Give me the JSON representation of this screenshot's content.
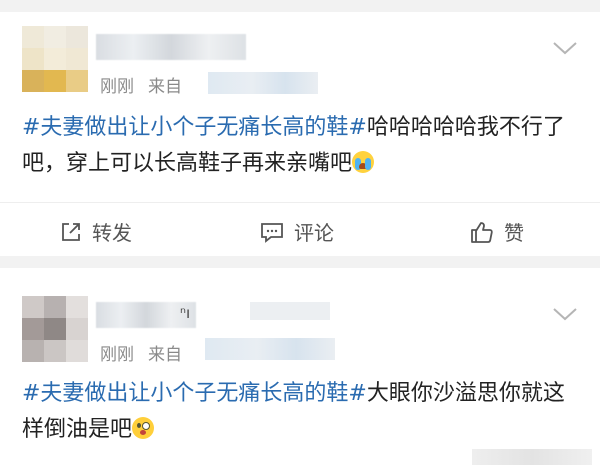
{
  "posts": [
    {
      "timestamp": "刚刚",
      "source_prefix": "来自",
      "topic": "#夫妻做出让小个子无痛长高的鞋#",
      "text": "哈哈哈哈哈我不行了吧，穿上可以长高鞋子再来亲嘴吧",
      "emoji": "loudly-crying-face",
      "avatar_colors": [
        "#efe9d8",
        "#f1ede2",
        "#ece7dc",
        "#eee4c8",
        "#f3ecd9",
        "#f0e8d4",
        "#d9b25a",
        "#e2b850",
        "#e9cc86"
      ]
    },
    {
      "name_visible_fragment": "ⁿı",
      "timestamp": "刚刚",
      "source_prefix": "来自",
      "topic": "#夫妻做出让小个子无痛长高的鞋#",
      "text": "大眼你沙溢思你就这样倒油是吧",
      "emoji": "winking-face-tongue",
      "avatar_colors": [
        "#cfc9c7",
        "#b7b1b0",
        "#e3dfdd",
        "#a39a98",
        "#8f8886",
        "#d8d3d1",
        "#b8b2b0",
        "#cbc6c4",
        "#e0dcda"
      ]
    }
  ],
  "actions": {
    "repost": "转发",
    "comment": "评论",
    "like": "赞"
  },
  "icons": {
    "expand": "chevron-down-icon",
    "repost": "repost-icon",
    "comment": "comment-icon",
    "like": "thumbs-up-icon"
  },
  "colors": {
    "topic_link": "#2a6bb0",
    "meta_text": "#8a8a8a",
    "background": "#f2f2f2"
  }
}
